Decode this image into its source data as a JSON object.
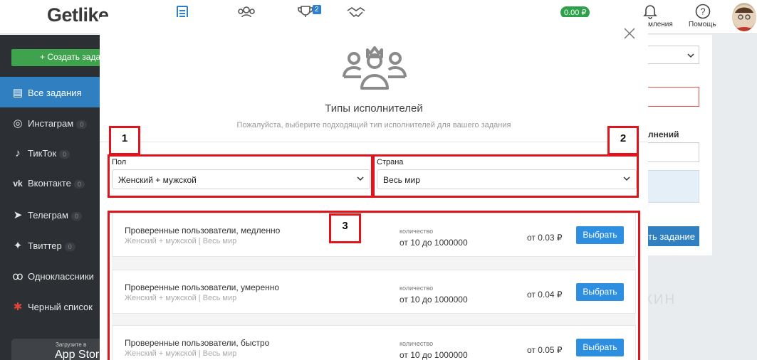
{
  "header": {
    "logo_bold": "Get",
    "logo_light": "like",
    "nav_badge": "2",
    "balance": "0.00 ₽",
    "notifications_label": "мления",
    "help_label": "Помощь"
  },
  "sidebar": {
    "create_button": "+ Создать задан",
    "items": [
      {
        "label": "Все задания",
        "count": "",
        "icon": "list-icon"
      },
      {
        "label": "Инстаграм",
        "count": "0",
        "icon": "instagram-icon"
      },
      {
        "label": "ТикТок",
        "count": "0",
        "icon": "tiktok-icon"
      },
      {
        "label": "Вконтакте",
        "count": "0",
        "icon": "vk-icon"
      },
      {
        "label": "Телеграм",
        "count": "0",
        "icon": "telegram-icon"
      },
      {
        "label": "Твиттер",
        "count": "0",
        "icon": "twitter-icon"
      },
      {
        "label": "Одноклассники",
        "count": "",
        "icon": "odnoklassniki-icon"
      },
      {
        "label": "Черный список",
        "count": "",
        "icon": "blacklist-icon"
      }
    ],
    "appstore_small": "Загрузите в",
    "appstore_big": "App Store"
  },
  "right_panel": {
    "label": "лнений",
    "button": "ть задание",
    "watermark": "ПАРТНЕРКИН"
  },
  "modal": {
    "title": "Типы исполнителей",
    "subtitle": "Пожалуйста, выберите подходящий тип исполнителей для вашего задания",
    "gender_label": "Пол",
    "gender_value": "Женский + мужской",
    "country_label": "Страна",
    "country_value": "Весь мир",
    "annotations": [
      "1",
      "2",
      "3"
    ],
    "options": [
      {
        "title": "Проверенные пользователи, медленно",
        "sub": "Женский + мужской | Весь мир",
        "qty_label": "количество",
        "qty_value": "от 10 до 1000000",
        "price": "от 0.03 ₽",
        "button": "Выбрать"
      },
      {
        "title": "Проверенные пользователи, умеренно",
        "sub": "Женский + мужской | Весь мир",
        "qty_label": "количество",
        "qty_value": "от 10 до 1000000",
        "price": "от 0.04 ₽",
        "button": "Выбрать"
      },
      {
        "title": "Проверенные пользователи, быстро",
        "sub": "Женский + мужской | Весь мир",
        "qty_label": "количество",
        "qty_value": "от 10 до 1000000",
        "price": "от 0.05 ₽",
        "button": "Выбрать"
      }
    ]
  },
  "colors": {
    "accent_blue": "#2e8fe0",
    "sidebar_bg": "#2c3035",
    "annotation_red": "#e0141c",
    "balance_green": "#2fa14a"
  }
}
